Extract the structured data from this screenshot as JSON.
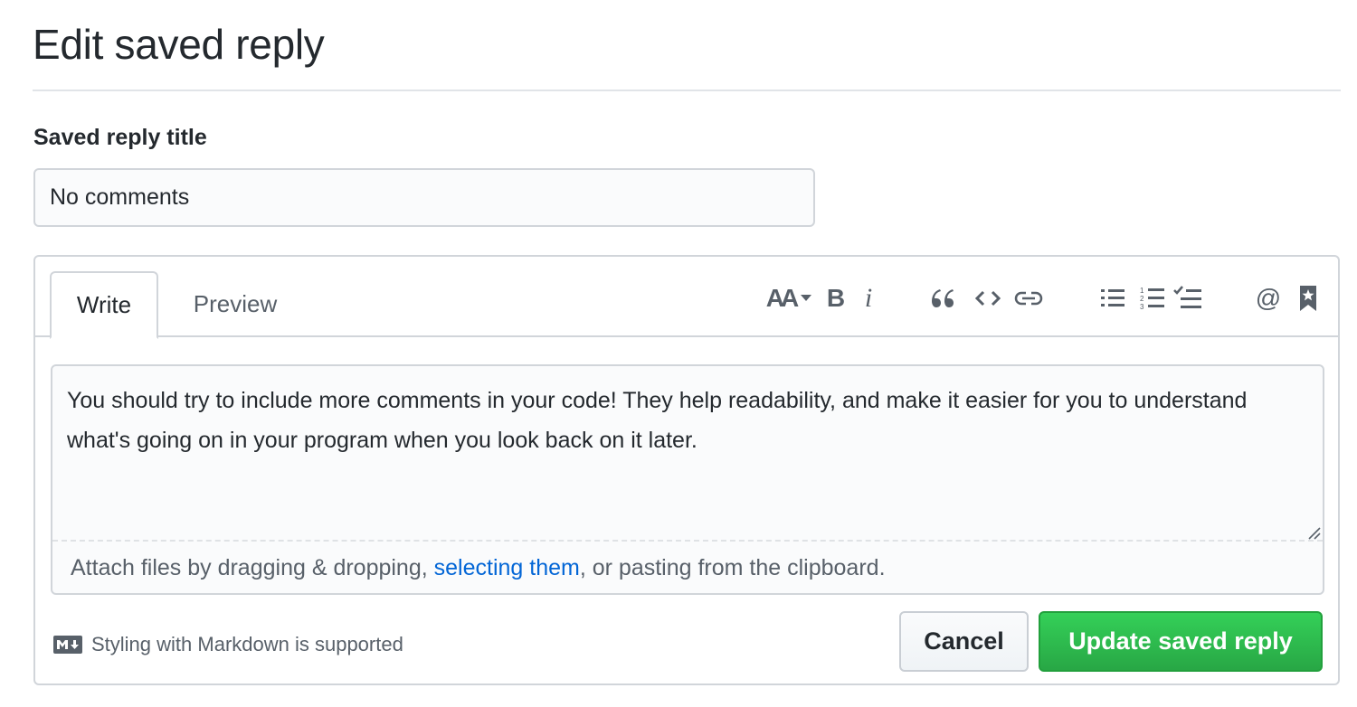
{
  "page": {
    "title": "Edit saved reply"
  },
  "form": {
    "title_label": "Saved reply title",
    "title_value": "No comments"
  },
  "editor": {
    "tabs": {
      "write": "Write",
      "preview": "Preview"
    },
    "toolbar_icons": [
      "text-size-icon",
      "bold-icon",
      "italic-icon",
      "quote-icon",
      "code-icon",
      "link-icon",
      "unordered-list-icon",
      "ordered-list-icon",
      "task-list-icon",
      "mention-icon",
      "saved-reply-icon"
    ],
    "toolbar_glyphs": {
      "text_size": "AA",
      "bold": "B",
      "italic": "i",
      "mention": "@"
    },
    "body": "You should try to include more comments in your code! They help readability, and make it easier for you to understand what's going on in your program when you look back on it later.",
    "attach": {
      "prefix": "Attach files by dragging & dropping, ",
      "link": "selecting them",
      "suffix": ", or pasting from the clipboard."
    },
    "markdown_note": "Styling with Markdown is supported"
  },
  "buttons": {
    "cancel": "Cancel",
    "submit": "Update saved reply"
  },
  "colors": {
    "link": "#0366d6",
    "submit_bg": "#28a745",
    "border": "#d1d5da",
    "muted": "#586069"
  }
}
